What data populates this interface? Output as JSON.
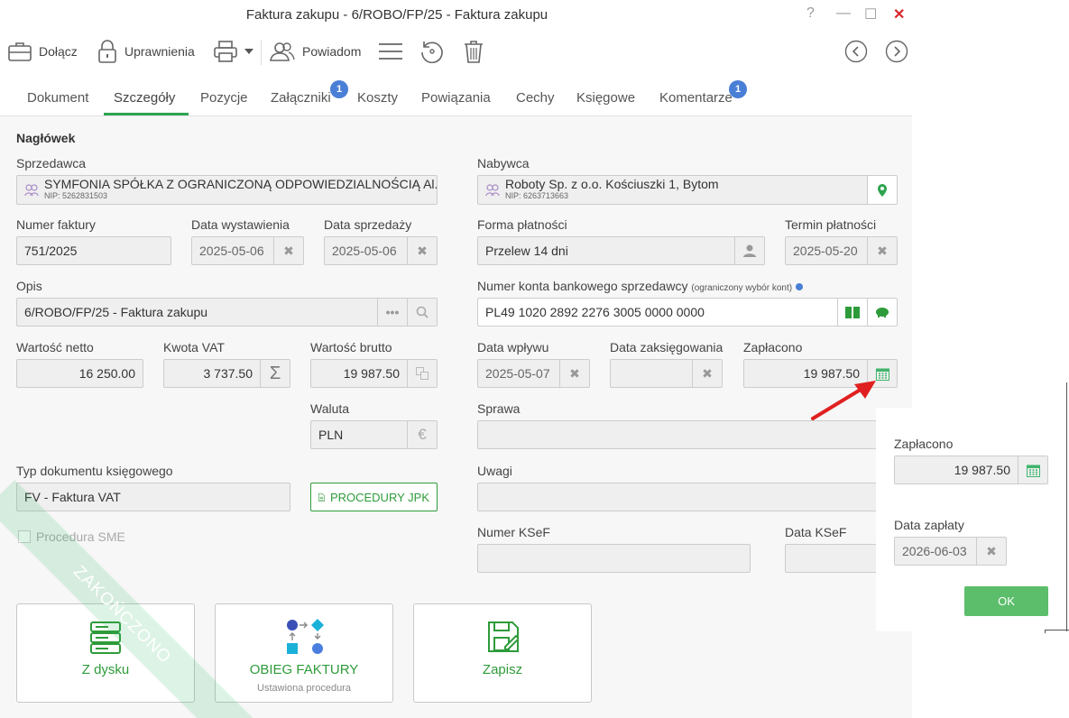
{
  "window": {
    "title": "Faktura zakupu - 6/ROBO/FP/25 - Faktura zakupu",
    "help": "?",
    "minimize": "—",
    "maximize": "☐",
    "close": "✕"
  },
  "toolbar": {
    "attach": "Dołącz",
    "permissions": "Uprawnienia",
    "notify": "Powiadom"
  },
  "tabs": {
    "items": [
      "Dokument",
      "Szczegóły",
      "Pozycje",
      "Załączniki",
      "Koszty",
      "Powiązania",
      "Cechy",
      "Księgowe",
      "Komentarze"
    ],
    "active": "Szczegóły",
    "attachments_badge": "1",
    "comments_badge": "1"
  },
  "header": {
    "section": "Nagłówek"
  },
  "seller": {
    "label": "Sprzedawca",
    "name": "SYMFONIA SPÓŁKA Z OGRANICZONĄ ODPOWIEDZIALNOŚCIĄ Al...",
    "nip": "NIP: 5262831503"
  },
  "buyer": {
    "label": "Nabywca",
    "name": "Roboty Sp. z o.o. Kościuszki 1, Bytom",
    "nip": "NIP: 6263713663"
  },
  "invoice_number": {
    "label": "Numer faktury",
    "value": "751/2025"
  },
  "issue_date": {
    "label": "Data wystawienia",
    "value": "2025-05-06"
  },
  "sale_date": {
    "label": "Data sprzedaży",
    "value": "2025-05-06"
  },
  "payment_form": {
    "label": "Forma płatności",
    "value": "Przelew 14 dni"
  },
  "payment_term": {
    "label": "Termin płatności",
    "value": "2025-05-20"
  },
  "description": {
    "label": "Opis",
    "value": "6/ROBO/FP/25 - Faktura zakupu"
  },
  "bank_account": {
    "label": "Numer konta bankowego sprzedawcy",
    "note": "(ograniczony wybór kont)",
    "value": "PL49 1020 2892 2276 3005 0000 0000"
  },
  "net": {
    "label": "Wartość netto",
    "value": "16 250.00"
  },
  "vat": {
    "label": "Kwota VAT",
    "value": "3 737.50"
  },
  "gross": {
    "label": "Wartość brutto",
    "value": "19 987.50"
  },
  "receipt_date": {
    "label": "Data wpływu",
    "value": "2025-05-07"
  },
  "posting_date": {
    "label": "Data zaksięgowania",
    "value": ""
  },
  "paid": {
    "label": "Zapłacono",
    "value": "19 987.50"
  },
  "currency": {
    "label": "Waluta",
    "value": "PLN"
  },
  "case": {
    "label": "Sprawa",
    "value": ""
  },
  "doc_type": {
    "label": "Typ dokumentu księgowego",
    "value": "FV - Faktura VAT"
  },
  "jpk": {
    "label": "PROCEDURY JPK"
  },
  "remarks": {
    "label": "Uwagi",
    "value": ""
  },
  "sme": {
    "label": "Procedura SME"
  },
  "ksef_number": {
    "label": "Numer KSeF",
    "value": ""
  },
  "ksef_date": {
    "label": "Data KSeF",
    "value": ""
  },
  "actions": {
    "from_disk": "Z dysku",
    "workflow": "OBIEG FAKTURY",
    "workflow_sub": "Ustawiona procedura",
    "save": "Zapisz"
  },
  "watermark": "ZAKOŃCZONO",
  "popup": {
    "paid_label": "Zapłacono",
    "paid_value": "19 987.50",
    "pay_date_label": "Data zapłaty",
    "pay_date_value": "2026-06-03",
    "ok": "OK"
  },
  "colors": {
    "accent": "#2ea44f",
    "badge": "#4a7fd6",
    "ok_button": "#5cbd6b",
    "arrow": "#e02020"
  }
}
